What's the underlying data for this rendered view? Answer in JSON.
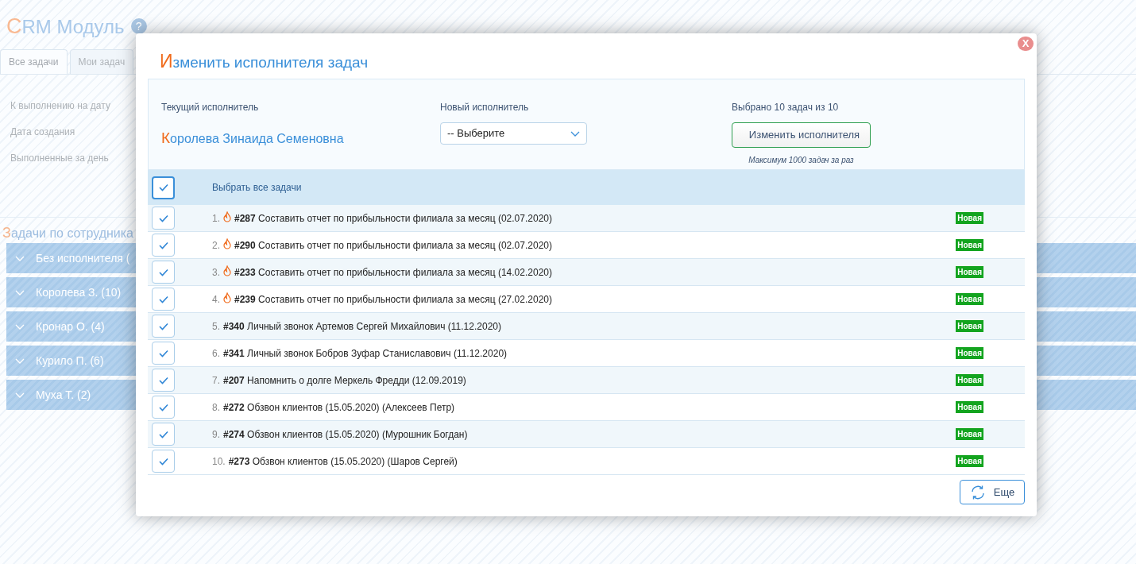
{
  "page": {
    "title": "CRM Модуль",
    "help": "?",
    "tabs": [
      {
        "label": "Все задачи",
        "selected": true
      },
      {
        "label": "Мои задач",
        "selected": false
      }
    ],
    "filters": [
      "К выполнению на дату",
      "Дата создания",
      "Выполненные за день"
    ],
    "section_title": "Задачи по сотрудника",
    "groups": [
      {
        "label": "Без исполнителя (",
        "expanded": false
      },
      {
        "label": "Королева З. (10)",
        "expanded": false
      },
      {
        "label": "Кронар О. (4)",
        "expanded": false
      },
      {
        "label": "Курило П. (6)",
        "expanded": false
      },
      {
        "label": "Муха Т. (2)",
        "expanded": false
      }
    ]
  },
  "dialog": {
    "title": "Изменить исполнителя задач",
    "close": "X",
    "current_label": "Текущий исполнитель",
    "current_value": "Королева Зинаида Семеновна",
    "new_label": "Новый исполнитель",
    "new_select": "-- Выберите",
    "selected_info": "Выбрано 10 задач из 10",
    "apply_button": "Изменить исполнителя",
    "limit_note": "Максимум 1000 задач за раз",
    "select_all": {
      "label": "Выбрать все задачи",
      "checked": true
    },
    "tasks": [
      {
        "number": "1.",
        "urgent": true,
        "text": "**#287** Составить отчет по прибыльности филиала за месяц (02.07.2020)",
        "status": "Новая",
        "checked": true
      },
      {
        "number": "2.",
        "urgent": true,
        "text": "**#290** Составить отчет по прибыльности филиала за месяц (02.07.2020)",
        "status": "Новая",
        "checked": true
      },
      {
        "number": "3.",
        "urgent": true,
        "text": "**#233** Составить отчет по прибыльности филиала за месяц (14.02.2020)",
        "status": "Новая",
        "checked": true
      },
      {
        "number": "4.",
        "urgent": true,
        "text": "**#239** Составить отчет по прибыльности филиала за месяц (27.02.2020)",
        "status": "Новая",
        "checked": true
      },
      {
        "number": "5.",
        "urgent": false,
        "text": "**#340** Личный звонок Артемов Сергей Михайлович (11.12.2020)",
        "status": "Новая",
        "checked": true
      },
      {
        "number": "6.",
        "urgent": false,
        "text": "**#341** Личный звонок Бобров Зуфар Станиславович (11.12.2020)",
        "status": "Новая",
        "checked": true
      },
      {
        "number": "7.",
        "urgent": false,
        "text": "**#207** Напомнить о долге Меркель Фредди (12.09.2019)",
        "status": "Новая",
        "checked": true
      },
      {
        "number": "8.",
        "urgent": false,
        "text": "**#272** Обзвон клиентов (15.05.2020) (Алексеев Петр)",
        "status": "Новая",
        "checked": true
      },
      {
        "number": "9.",
        "urgent": false,
        "text": "**#274** Обзвон клиентов (15.05.2020) (Мурошник Богдан)",
        "status": "Новая",
        "checked": true
      },
      {
        "number": "10.",
        "urgent": false,
        "text": "**#273** Обзвон клиентов (15.05.2020) (Шаров Сергей)",
        "status": "Новая",
        "checked": true
      }
    ],
    "more_button": "Еще"
  }
}
